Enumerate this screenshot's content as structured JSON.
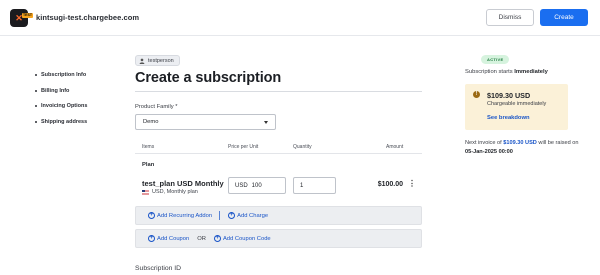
{
  "header": {
    "logo_badge": "TEST",
    "site": "kintsugi-test.chargebee.com",
    "dismiss_label": "Dismiss",
    "create_label": "Create"
  },
  "nav": {
    "items": [
      {
        "label": "Subscription Info"
      },
      {
        "label": "Billing Info"
      },
      {
        "label": "Invoicing Options"
      },
      {
        "label": "Shipping address"
      }
    ]
  },
  "main": {
    "user_chip": "testperson",
    "title": "Create a subscription",
    "product_family": {
      "label": "Product Family *",
      "value": "Demo"
    },
    "table": {
      "headers": [
        "Items",
        "Price per Unit",
        "Quantity",
        "Amount"
      ],
      "plan_heading": "Plan",
      "row": {
        "name": "test_plan USD Monthly",
        "sub": "USD, Monthly plan",
        "currency": "USD",
        "price": "100",
        "quantity": "1",
        "amount": "$100.00"
      }
    },
    "actions": {
      "add_recurring_addon": "Add Recurring Addon",
      "add_charge": "Add Charge",
      "add_coupon": "Add Coupon",
      "or": "OR",
      "add_coupon_code": "Add Coupon Code"
    },
    "subscription_id_label": "Subscription ID"
  },
  "summary": {
    "status": "ACTIVE",
    "starts_prefix": "Subscription starts ",
    "starts_value": "Immediately",
    "charge_amount": "$109.30 USD",
    "charge_note": "Chargeable immediately",
    "breakdown_link": "See breakdown",
    "next_prefix": "Next invoice of ",
    "next_amount": "$109.30 USD",
    "next_middle": " will be raised on ",
    "next_date": "05-Jan-2025 00:00"
  },
  "colors": {
    "primary": "#1a6ef0",
    "link": "#1a55c8",
    "card_bg": "#fbf1d8",
    "badge_bg": "#d6f3de"
  }
}
